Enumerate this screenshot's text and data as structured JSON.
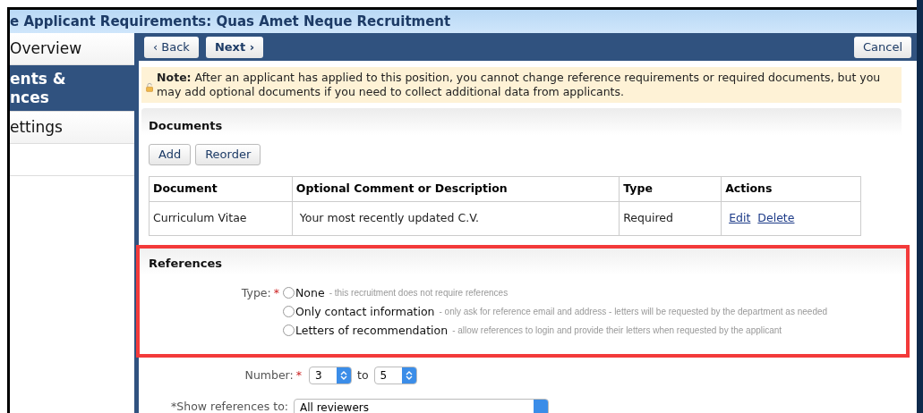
{
  "window": {
    "title": "e Applicant Requirements: Quas Amet Neque Recruitment"
  },
  "sidebar": {
    "items": [
      {
        "lines": [
          "Overview"
        ],
        "selected": false
      },
      {
        "lines": [
          "ents &",
          "nces"
        ],
        "selected": true
      },
      {
        "lines": [
          "ettings"
        ],
        "selected": false
      }
    ]
  },
  "toolbar": {
    "back": "‹ Back",
    "next": "Next ›",
    "cancel": "Cancel"
  },
  "note": {
    "text": "**Note:** After an applicant has applied to this position, you cannot change reference requirements or required documents, but you may add optional documents if you need to collect additional data from applicants."
  },
  "documents": {
    "title": "Documents",
    "buttons": [
      "Add",
      "Reorder"
    ],
    "columns": [
      "Document",
      "Optional Comment or Description",
      "Type",
      "Actions"
    ],
    "rows": [
      {
        "document": "Curriculum Vitae",
        "description": "Your most recently updated C.V.",
        "type": "Required",
        "actions": [
          "Edit",
          "Delete"
        ]
      }
    ]
  },
  "references": {
    "title": "References",
    "type_label": "Type:",
    "required_mark": "*",
    "options": [
      {
        "label": "None",
        "hint": "- this recruitment does not require references",
        "selected": false
      },
      {
        "label": "Only contact information",
        "hint": "- only ask for reference email and address - letters will be requested by the department as needed",
        "selected": false
      },
      {
        "label": "Letters of recommendation",
        "hint": "- allow references to login and provide their letters when requested by the applicant",
        "selected": false
      }
    ],
    "number_label": "Number:",
    "number_from": "3",
    "to": "to",
    "number_to": "5",
    "show_label": "*Show references to:",
    "show_value": "All reviewers"
  }
}
